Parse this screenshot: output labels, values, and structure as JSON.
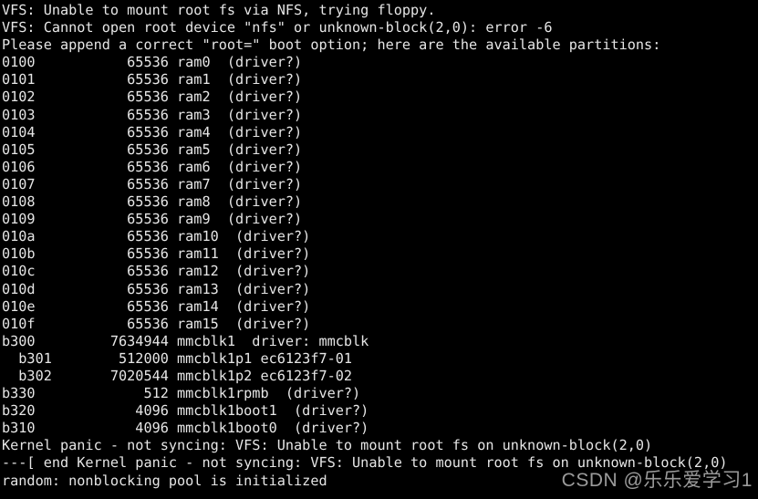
{
  "terminal": {
    "background_color": "#000000",
    "text_color": "#e6e6e6",
    "lines": [
      "VFS: Unable to mount root fs via NFS, trying floppy.",
      "VFS: Cannot open root device \"nfs\" or unknown-block(2,0): error -6",
      "Please append a correct \"root=\" boot option; here are the available partitions:",
      "0100           65536 ram0  (driver?)",
      "0101           65536 ram1  (driver?)",
      "0102           65536 ram2  (driver?)",
      "0103           65536 ram3  (driver?)",
      "0104           65536 ram4  (driver?)",
      "0105           65536 ram5  (driver?)",
      "0106           65536 ram6  (driver?)",
      "0107           65536 ram7  (driver?)",
      "0108           65536 ram8  (driver?)",
      "0109           65536 ram9  (driver?)",
      "010a           65536 ram10  (driver?)",
      "010b           65536 ram11  (driver?)",
      "010c           65536 ram12  (driver?)",
      "010d           65536 ram13  (driver?)",
      "010e           65536 ram14  (driver?)",
      "010f           65536 ram15  (driver?)",
      "b300         7634944 mmcblk1  driver: mmcblk",
      "  b301        512000 mmcblk1p1 ec6123f7-01",
      "  b302       7020544 mmcblk1p2 ec6123f7-02",
      "b330             512 mmcblk1rpmb  (driver?)",
      "b320            4096 mmcblk1boot1  (driver?)",
      "b310            4096 mmcblk1boot0  (driver?)",
      "Kernel panic - not syncing: VFS: Unable to mount root fs on unknown-block(2,0)",
      "---[ end Kernel panic - not syncing: VFS: Unable to mount root fs on unknown-block(2,0)",
      "random: nonblocking pool is initialized"
    ]
  },
  "watermark": {
    "text": "CSDN @乐乐爱学习1",
    "color": "#9b9b9b"
  }
}
